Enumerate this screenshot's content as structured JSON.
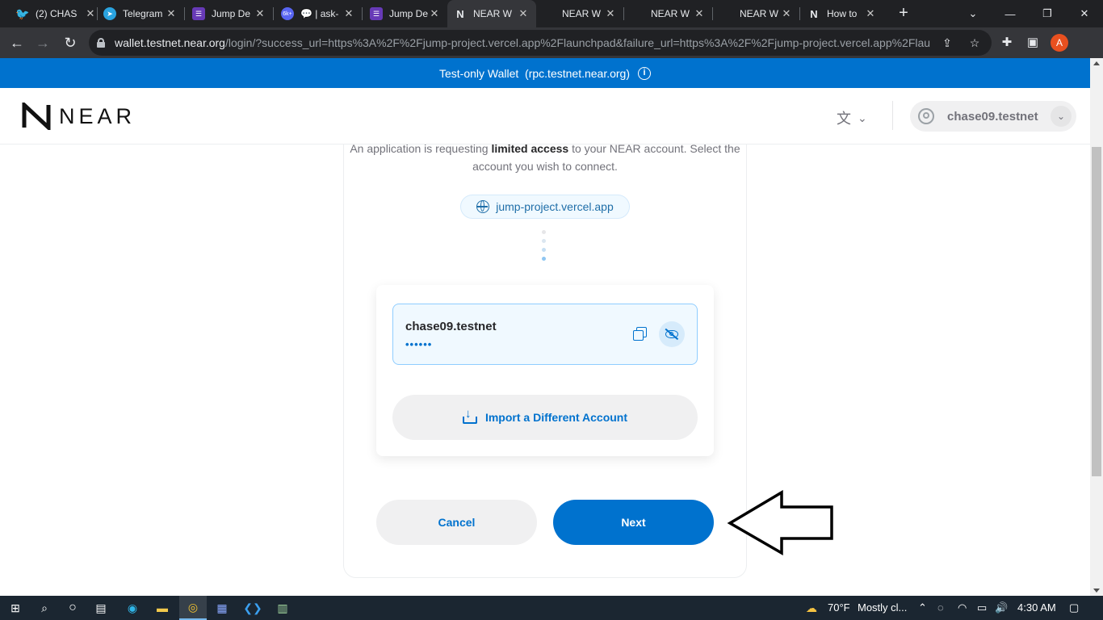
{
  "browser": {
    "tabs": [
      {
        "title": "(2) CHAS",
        "icon": "twitter-icon",
        "color": "#1d9bf0"
      },
      {
        "title": "Telegram",
        "icon": "telegram-icon",
        "color": "#2aa3df"
      },
      {
        "title": "Jump De",
        "icon": "form-icon",
        "color": "#673ab7"
      },
      {
        "title": "💬 | ask-",
        "icon": "discord-icon",
        "color": "#5865f2",
        "badge": "6k+"
      },
      {
        "title": "Jump De",
        "icon": "form-icon",
        "color": "#673ab7"
      },
      {
        "title": "NEAR W",
        "icon": "near-icon",
        "color": "#35363a",
        "active": true
      },
      {
        "title": "NEAR W",
        "icon": "blank-icon",
        "color": "#202124"
      },
      {
        "title": "NEAR W",
        "icon": "blank-icon",
        "color": "#202124"
      },
      {
        "title": "NEAR W",
        "icon": "blank-icon",
        "color": "#202124"
      },
      {
        "title": "How to",
        "icon": "near-icon",
        "color": "#202124"
      }
    ],
    "url_host": "wallet.testnet.near.org",
    "url_path": "/login/?success_url=https%3A%2F%2Fjump-project.vercel.app%2Flaunchpad&failure_url=https%3A%2F%2Fjump-project.vercel.app%2Flaun...",
    "profile_initial": "A"
  },
  "banner": {
    "text": "Test-only Wallet  (rpc.testnet.near.org)"
  },
  "header": {
    "logo_text": "NEAR",
    "account_name": "chase09.testnet"
  },
  "login": {
    "intro_before": "An application is requesting ",
    "intro_bold": "limited access",
    "intro_after": " to your NEAR account. Select the account you wish to connect.",
    "origin": "jump-project.vercel.app",
    "selected_account": "chase09.testnet",
    "balance_masked": "••••••",
    "import_label": "Import a Different Account",
    "cancel_label": "Cancel",
    "next_label": "Next"
  },
  "taskbar": {
    "temperature": "70°F",
    "weather": "Mostly cl...",
    "time": "4:30 AM"
  },
  "colors": {
    "near_blue": "#0072ce",
    "chrome_dark": "#202124"
  }
}
